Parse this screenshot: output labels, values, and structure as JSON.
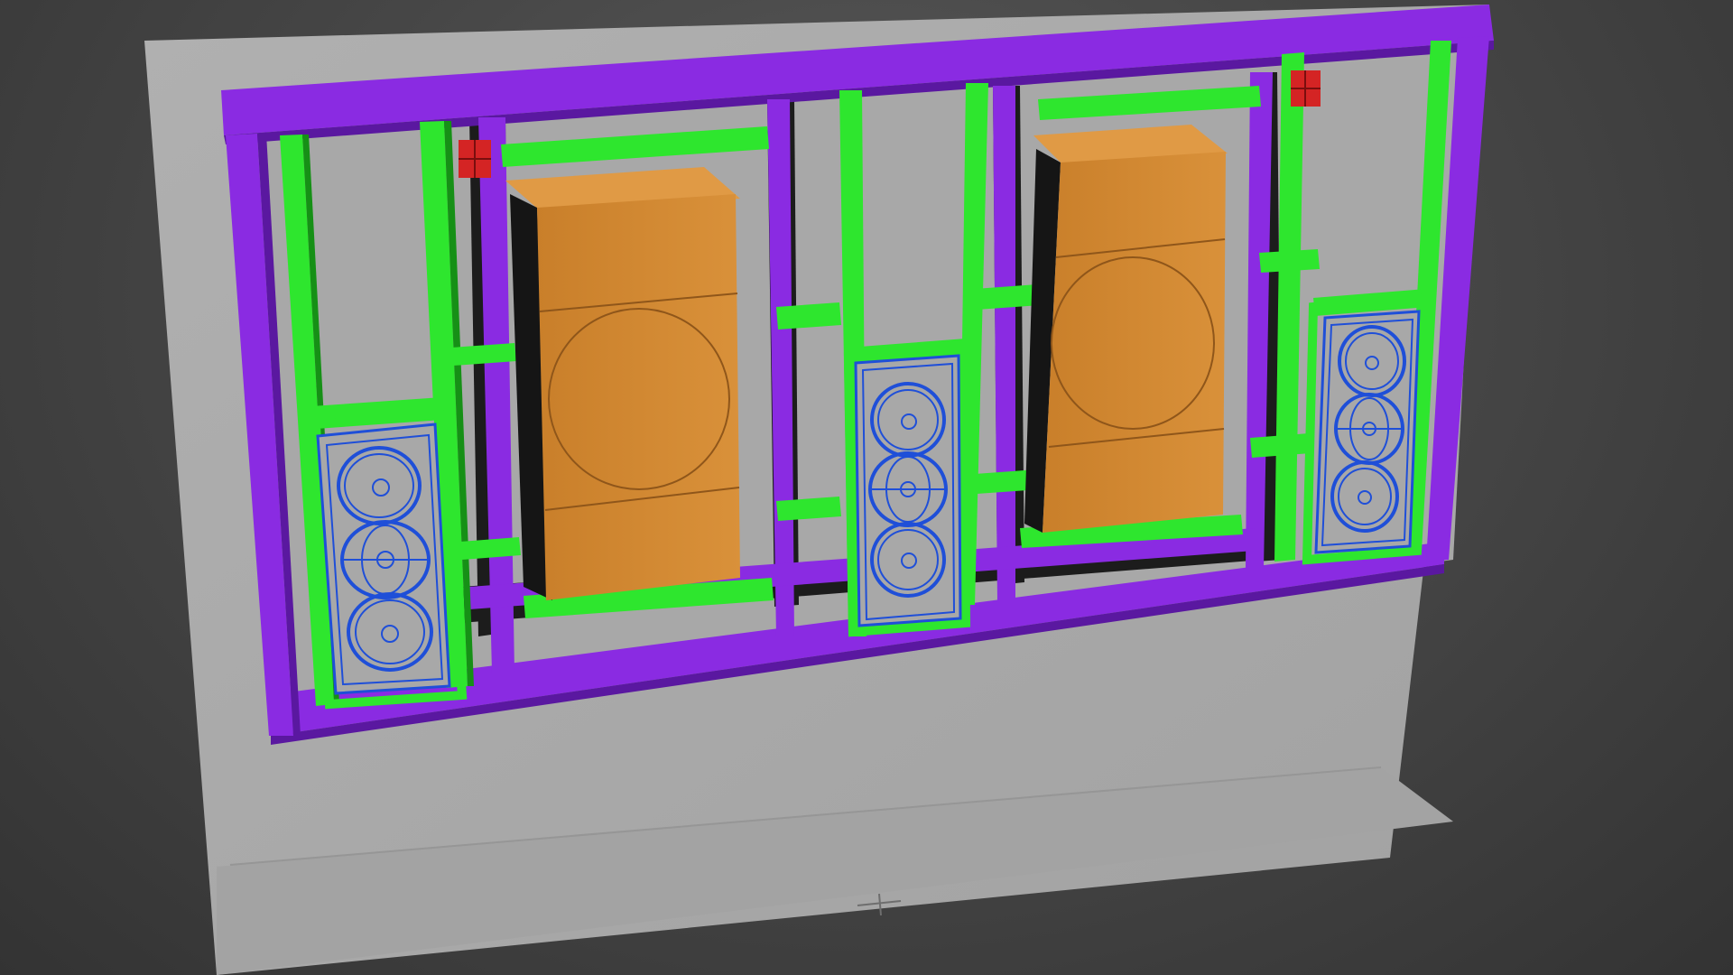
{
  "viewport": {
    "label": "",
    "background_color": "#3b3b3b"
  },
  "scene": {
    "colors": {
      "wall": "#a9a9a9",
      "wall_edge": "#9c9c9c",
      "floor": "#a5a5a5",
      "frame_purple": "#8a2be2",
      "frame_purple_dark": "#5a18a0",
      "stud_green": "#2ee62e",
      "stud_green_dark": "#169016",
      "subwoofer_orange": "#d4872e",
      "subwoofer_orange_dark": "#8f561a",
      "speaker_blue": "#1f4fd8",
      "marker_red": "#d42424",
      "shadow": "#151515"
    },
    "objects": [
      "wall-panel",
      "floor-plane",
      "purple-frame",
      "green-studs",
      "subwoofer-left",
      "subwoofer-right",
      "speaker-left",
      "speaker-center",
      "speaker-right",
      "junction-box-left",
      "junction-box-right",
      "pivot-gizmo"
    ]
  }
}
